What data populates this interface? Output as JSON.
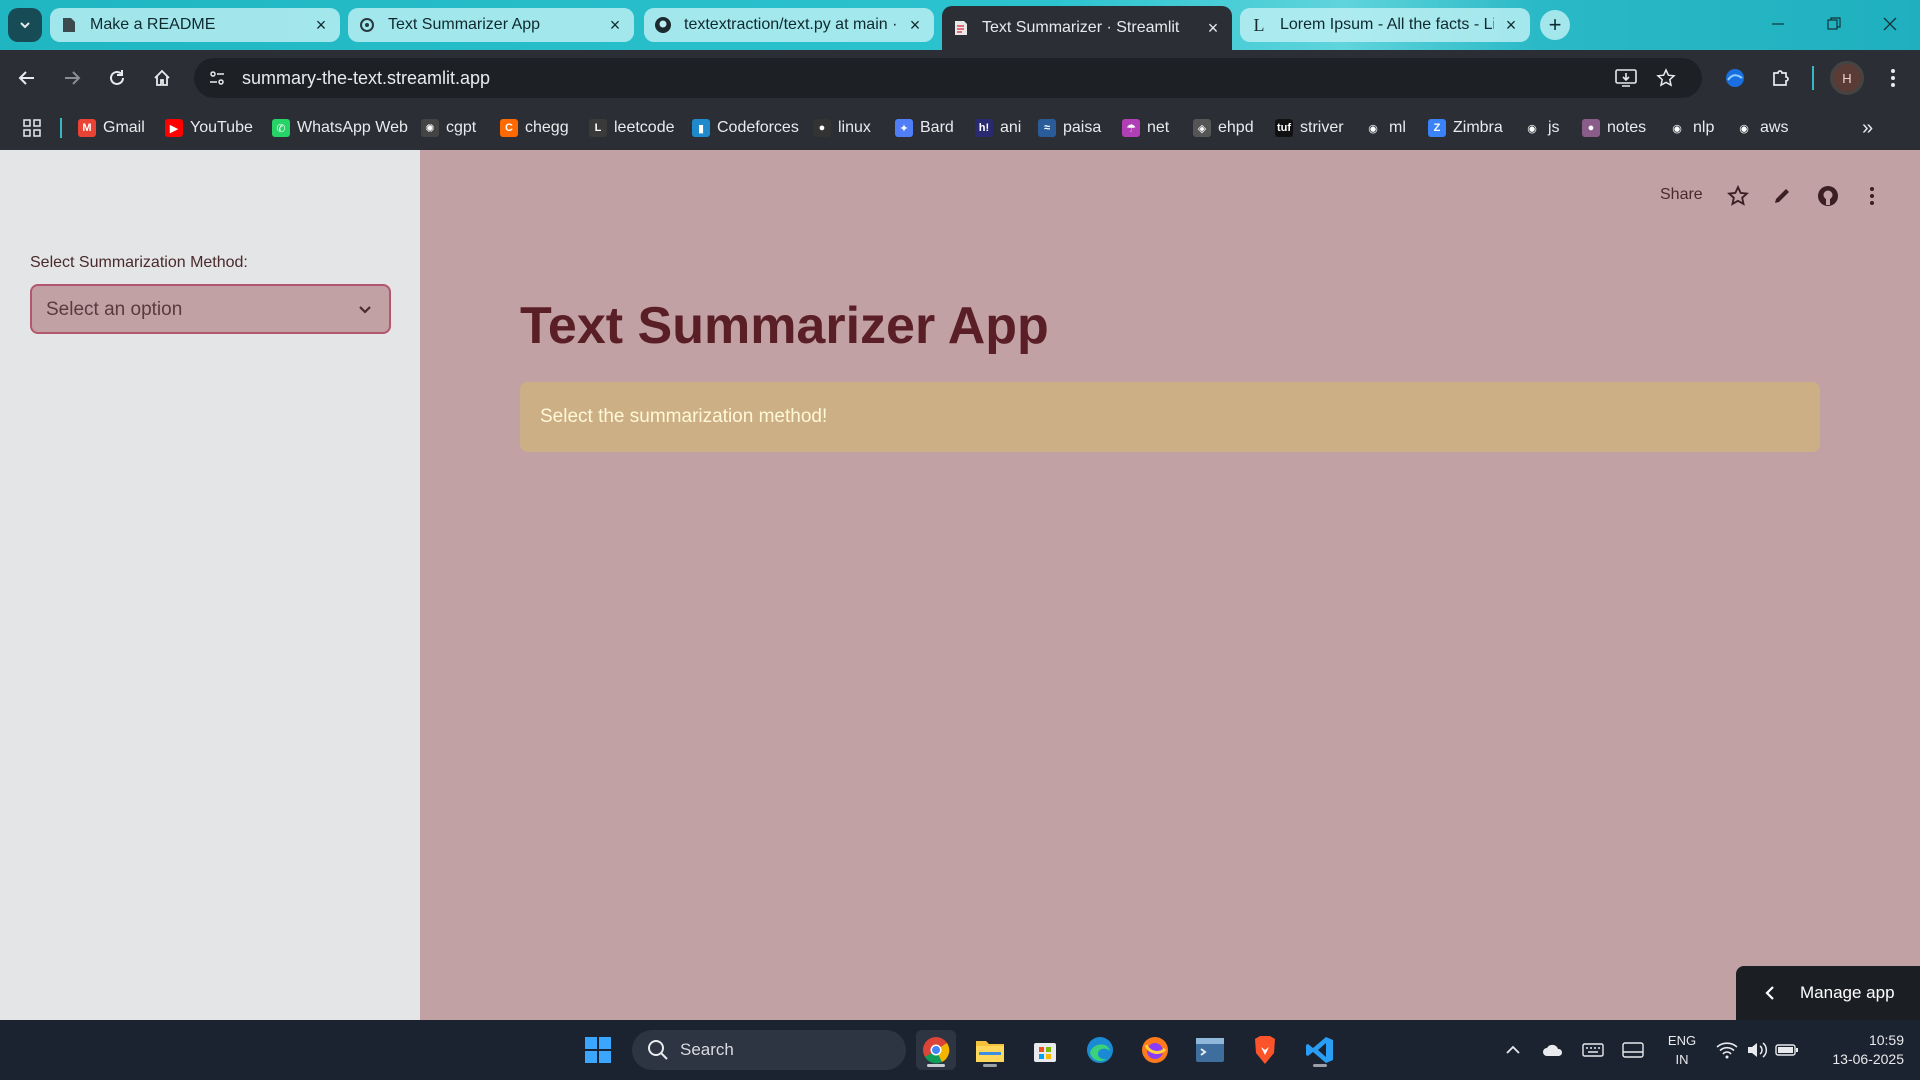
{
  "browser": {
    "tabs": [
      {
        "title": "Make a README",
        "icon": "document-icon"
      },
      {
        "title": "Text Summarizer App",
        "icon": "chatgpt-icon"
      },
      {
        "title": "textextraction/text.py at main · I",
        "icon": "github-icon"
      },
      {
        "title": "Text Summarizer · Streamlit",
        "icon": "streamlit-icon"
      },
      {
        "title": "Lorem Ipsum - All the facts - Li",
        "icon": "lorem-icon"
      }
    ],
    "active_tab_index": 3,
    "url": "summary-the-text.streamlit.app",
    "profile_initial": "H"
  },
  "bookmarks": [
    {
      "label": "Gmail",
      "color": "#ea4335",
      "glyph": "M"
    },
    {
      "label": "YouTube",
      "color": "#ff0000",
      "glyph": "▶"
    },
    {
      "label": "WhatsApp Web",
      "color": "#25d366",
      "glyph": "✆"
    },
    {
      "label": "cgpt",
      "color": "#444444",
      "glyph": "✺"
    },
    {
      "label": "chegg",
      "color": "#ff6a00",
      "glyph": "C"
    },
    {
      "label": "leetcode",
      "color": "#3a3a3a",
      "glyph": "L"
    },
    {
      "label": "Codeforces",
      "color": "#1f8acb",
      "glyph": "▮"
    },
    {
      "label": "linux",
      "color": "#333333",
      "glyph": "●"
    },
    {
      "label": "Bard",
      "color": "#4f7ef7",
      "glyph": "✦"
    },
    {
      "label": "ani",
      "color": "#2a2a70",
      "glyph": "h!"
    },
    {
      "label": "paisa",
      "color": "#2a5c9a",
      "glyph": "≈"
    },
    {
      "label": "net",
      "color": "#b03fb5",
      "glyph": "☂"
    },
    {
      "label": "ehpd",
      "color": "#555555",
      "glyph": "◈"
    },
    {
      "label": "striver",
      "color": "#111111",
      "glyph": "tuf"
    },
    {
      "label": "ml",
      "color": "#2b2f35",
      "glyph": "◉"
    },
    {
      "label": "Zimbra",
      "color": "#3b82f6",
      "glyph": "Z"
    },
    {
      "label": "js",
      "color": "#2b2f35",
      "glyph": "◉"
    },
    {
      "label": "notes",
      "color": "#8a5c8a",
      "glyph": "●"
    },
    {
      "label": "nlp",
      "color": "#2b2f35",
      "glyph": "◉"
    },
    {
      "label": "aws",
      "color": "#2b2f35",
      "glyph": "◉"
    }
  ],
  "app": {
    "sidebar": {
      "select_label": "Select Summarization Method:",
      "select_placeholder": "Select an option"
    },
    "header": {
      "share_label": "Share"
    },
    "title": "Text Summarizer App",
    "alert_text": "Select the summarization method!",
    "manage_app_label": "Manage app",
    "colors": {
      "sidebar_bg": "#e3e5e6",
      "main_bg": "#c2a1a5",
      "title": "#5a1f26",
      "alert_bg": "#cdaf86",
      "select_border": "#b3566f"
    }
  },
  "taskbar": {
    "search_label": "Search",
    "language": "ENG",
    "region": "IN",
    "time": "10:59",
    "date": "13-06-2025",
    "apps": [
      "windows-start",
      "chrome",
      "file-explorer",
      "microsoft-store",
      "edge",
      "firefox",
      "terminal",
      "brave",
      "vscode"
    ]
  }
}
